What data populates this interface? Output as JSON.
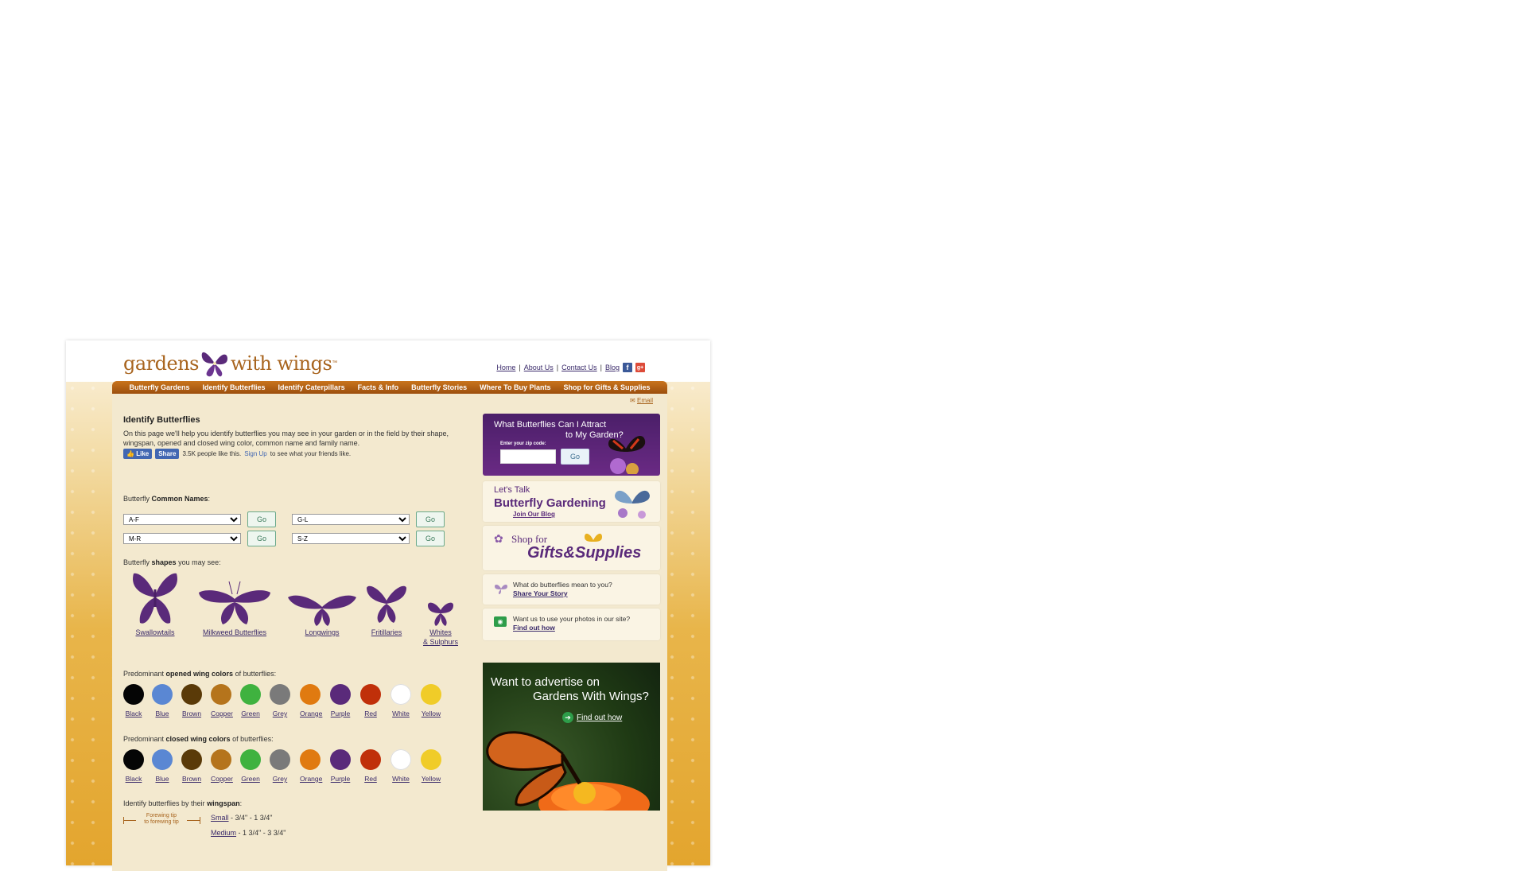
{
  "header": {
    "logo_left": "gardens",
    "logo_right": "with wings",
    "logo_tm": "™",
    "links": [
      "Home",
      "About Us",
      "Contact Us",
      "Blog"
    ]
  },
  "nav": [
    "Butterfly Gardens",
    "Identify Butterflies",
    "Identify Caterpillars",
    "Facts & Info",
    "Butterfly Stories",
    "Where To Buy Plants",
    "Shop for Gifts & Supplies"
  ],
  "email": "Email",
  "main": {
    "title": "Identify Butterflies",
    "intro": "On this page we'll help you identify butterflies you may see in your garden or in the field by their shape, wingspan, opened and closed wing color, common name and family name.",
    "fb": {
      "like": "Like",
      "share": "Share",
      "count_text": "3.5K people like this.",
      "signup": "Sign Up",
      "rest": "to see what your friends like."
    },
    "common_names_label_pre": "Butterfly",
    "common_names_label_bold": "Common Names",
    "common_names_label_post": ":",
    "selects": [
      "A-F",
      "G-L",
      "M-R",
      "S-Z"
    ],
    "go": "Go",
    "shapes_label_pre": "Butterfly",
    "shapes_label_bold": "shapes",
    "shapes_label_post": "you may see:",
    "shapes": [
      "Swallowtails",
      "Milkweed Butterflies",
      "Longwings",
      "Fritillaries",
      "Whites",
      "& Sulphurs"
    ],
    "open_label_pre": "Predominant",
    "open_label_bold": "opened wing colors",
    "open_label_post": "of butterflies:",
    "closed_label_pre": "Predominant",
    "closed_label_bold": "closed wing colors",
    "closed_label_post": "of butterflies:",
    "colors": [
      {
        "name": "Black",
        "hex": "#050505"
      },
      {
        "name": "Blue",
        "hex": "#5a87d3"
      },
      {
        "name": "Brown",
        "hex": "#5a3a08"
      },
      {
        "name": "Copper",
        "hex": "#b5741c"
      },
      {
        "name": "Green",
        "hex": "#3fb23f"
      },
      {
        "name": "Grey",
        "hex": "#7a7a7a"
      },
      {
        "name": "Orange",
        "hex": "#e07a10"
      },
      {
        "name": "Purple",
        "hex": "#5a2a7a"
      },
      {
        "name": "Red",
        "hex": "#c0300a"
      },
      {
        "name": "White",
        "hex": "#ffffff"
      },
      {
        "name": "Yellow",
        "hex": "#f0cc28"
      }
    ],
    "wingspan_label_pre": "Identify butterflies by their",
    "wingspan_label_bold": "wingspan",
    "wingspan_label_post": ":",
    "wingspan_diagram": [
      "Forewing tip",
      "to forewing tip"
    ],
    "wingspans": [
      {
        "name": "Small",
        "range": "- 3/4\" - 1 3/4\""
      },
      {
        "name": "Medium",
        "range": "- 1 3/4\" - 3 3/4\""
      }
    ]
  },
  "sidebar": {
    "attract_line1": "What Butterflies Can I Attract",
    "attract_line2": "to My Garden?",
    "zip_label": "Enter your zip code:",
    "zip_go": "Go",
    "blog_small": "Let's Talk",
    "blog_big": "Butterfly Gardening",
    "blog_join": "Join Our Blog",
    "shop_line1": "Shop for",
    "shop_line2": "Gifts&Supplies",
    "story_question": "What do butterflies mean to you?",
    "story_link": "Share Your Story",
    "photo_question": "Want us to use your photos in our site?",
    "photo_link": "Find out how",
    "ad_line1": "Want to advertise on",
    "ad_line2": "Gardens With Wings?",
    "ad_link": "Find out how"
  }
}
